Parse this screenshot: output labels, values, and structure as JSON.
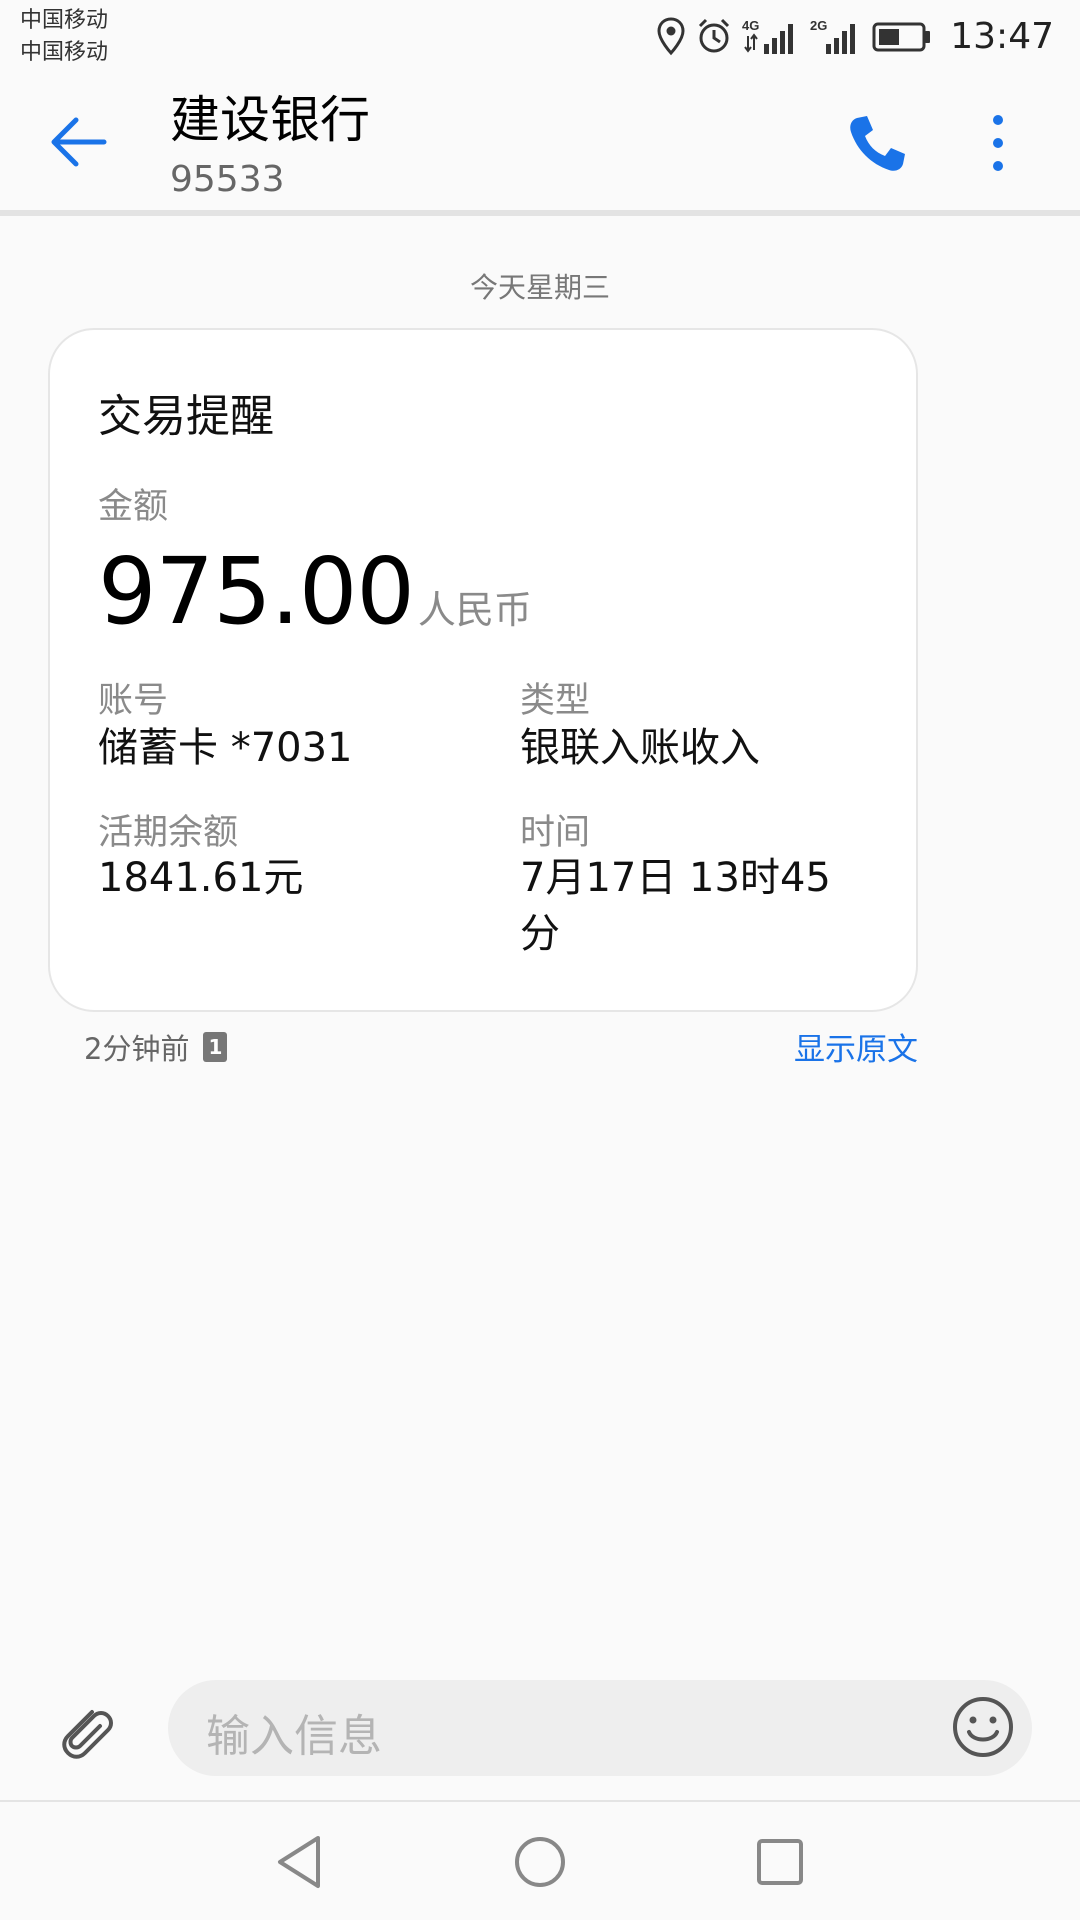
{
  "status_bar": {
    "carrier_1": "中国移动",
    "carrier_2": "中国移动",
    "network_1": "4G",
    "network_2": "2G",
    "time": "13:47"
  },
  "header": {
    "title": "建设银行",
    "number": "95533"
  },
  "conversation": {
    "date_separator": "今天星期三"
  },
  "message_card": {
    "title": "交易提醒",
    "amount_label": "金额",
    "amount": "975.00",
    "currency": "人民币",
    "account_label": "账号",
    "account_value": "储蓄卡 *7031",
    "type_label": "类型",
    "type_value": "银联入账收入",
    "balance_label": "活期余额",
    "balance_value": "1841.61元",
    "time_label": "时间",
    "time_value_line1": "7月17日 13时45",
    "time_value_line2": "分"
  },
  "message_meta": {
    "relative_time": "2分钟前",
    "sim_slot": "1",
    "show_original": "显示原文"
  },
  "composer": {
    "placeholder": "输入信息"
  },
  "colors": {
    "accent": "#1a73e8",
    "background": "#fafafa",
    "card": "#ffffff"
  }
}
